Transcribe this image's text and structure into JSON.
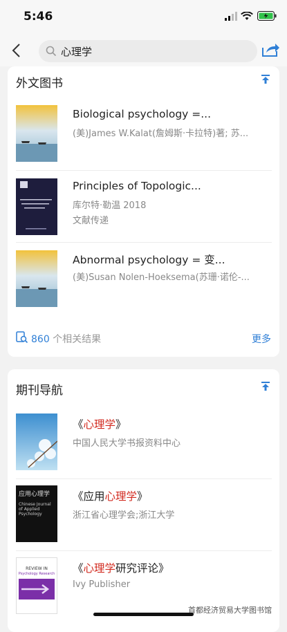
{
  "status": {
    "time": "5:46"
  },
  "search": {
    "query": "心理学"
  },
  "books": {
    "title": "外文图书",
    "items": [
      {
        "title": "Biological psychology =...",
        "line2": "(美)James W.Kalat(詹姆斯·卡拉特)著; 苏..."
      },
      {
        "title": "Principles of Topologic...",
        "line2": "库尔特·勒温 2018",
        "line3": "文献传递"
      },
      {
        "title": "Abnormal psychology = 变...",
        "line2": "(美)Susan Nolen-Hoeksema(苏珊·诺伦-..."
      }
    ],
    "count": "860",
    "count_suffix": "个相关结果",
    "more": "更多"
  },
  "journals": {
    "title": "期刊导航",
    "items": [
      {
        "pre": "《",
        "hl": "心理学",
        "post": "》",
        "publisher": "中国人民大学书报资料中心"
      },
      {
        "pre": "《应用",
        "hl": "心理学",
        "post": "》",
        "publisher": "浙江省心理学会;浙江大学"
      },
      {
        "pre": "《",
        "hl": "心理学",
        "post": "研究评论》",
        "publisher": "Ivy Publisher"
      }
    ],
    "covers": {
      "c2_title_cn": "应用心理学",
      "c2_subtitle": "Chinese Journal of Applied Psychology",
      "c3_band": "REVIEW IN",
      "c3_sub": "Psychology Research"
    }
  },
  "watermark": "首都经济贸易大学图书馆"
}
